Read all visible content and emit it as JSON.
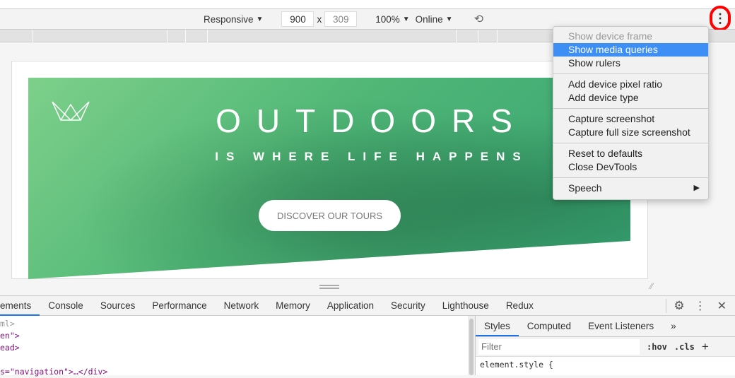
{
  "toolbar": {
    "device": "Responsive",
    "width": "900",
    "times": "x",
    "height": "309",
    "zoom": "100%",
    "throttle": "Online",
    "rotate_icon": "rotate-icon",
    "more_icon": "kebab-menu-icon"
  },
  "page": {
    "title": "OUTDOORS",
    "subtitle": "IS WHERE LIFE HAPPENS",
    "cta": "DISCOVER OUR TOURS",
    "logo": "crown-logo"
  },
  "menu": {
    "items": [
      {
        "label": "Show device frame",
        "disabled": true
      },
      {
        "label": "Show media queries",
        "highlighted": true
      },
      {
        "label": "Show rulers"
      },
      {
        "label": "Add device pixel ratio"
      },
      {
        "label": "Add device type"
      },
      {
        "label": "Capture screenshot"
      },
      {
        "label": "Capture full size screenshot"
      },
      {
        "label": "Reset to defaults"
      },
      {
        "label": "Close DevTools"
      },
      {
        "label": "Speech",
        "submenu": true
      }
    ]
  },
  "devtools": {
    "tabs": [
      "ements",
      "Console",
      "Sources",
      "Performance",
      "Network",
      "Memory",
      "Application",
      "Security",
      "Lighthouse",
      "Redux"
    ],
    "elements_lines": [
      "ml>",
      "en\">",
      "ead>",
      "",
      "s=\"navigation\">…</div>"
    ],
    "styles_tabs": [
      "Styles",
      "Computed",
      "Event Listeners",
      "»"
    ],
    "filter_placeholder": "Filter",
    "hov": ":hov",
    "cls": ".cls",
    "plus": "+",
    "element_style": "element.style {"
  },
  "colors": {
    "accent": "#1a73e8",
    "highlight": "#3d8ef5",
    "hero_green": "#4fb676",
    "annotation": "#ff0000"
  }
}
